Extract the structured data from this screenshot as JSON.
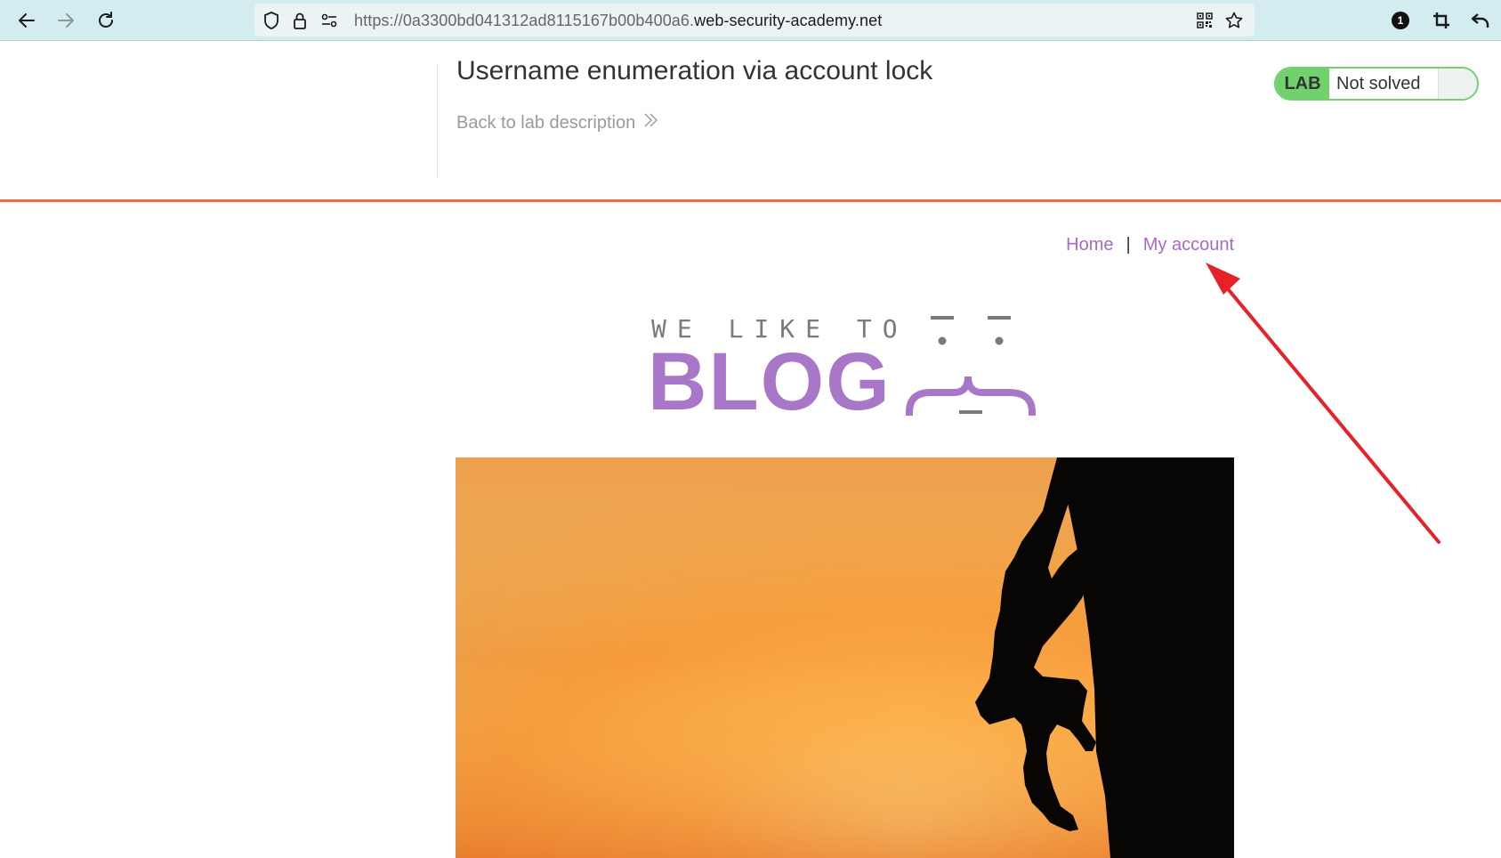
{
  "browser": {
    "url_prefix": "https://0a3300bd041312ad8115167b00b400a6.",
    "url_host": "web-security-academy.net",
    "notification_count": "1",
    "icons": {
      "back": "back-arrow-icon",
      "forward": "forward-arrow-icon",
      "reload": "reload-icon",
      "shield": "shield-icon",
      "lock": "lock-icon",
      "permissions": "permissions-icon",
      "qr": "qr-code-icon",
      "bookmark": "star-icon",
      "extension": "notification-badge-icon",
      "crop": "crop-icon",
      "undo": "undo-icon"
    }
  },
  "lab": {
    "title": "Username enumeration via account lock",
    "back_link": "Back to lab description",
    "badge": "LAB",
    "status": "Not solved"
  },
  "nav": {
    "home": "Home",
    "separator": "|",
    "my_account": "My account"
  },
  "logo": {
    "tagline": "WE LIKE TO",
    "word": "BLOG"
  },
  "colors": {
    "toolbar": "#d3ecef",
    "accent_orange": "#ee6b44",
    "lab_green": "#70d16d",
    "link_purple": "#a66ac8",
    "logo_purple": "#a877c8",
    "annotation_red": "#e8202a"
  }
}
